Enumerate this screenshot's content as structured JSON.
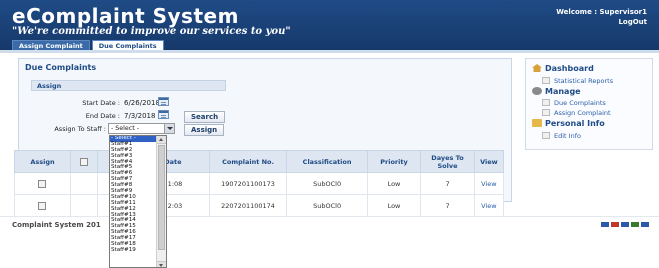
{
  "header": {
    "title": "eComplaint System",
    "tagline": "\"We're committed to improve our services to you\"",
    "welcome": "Welcome : Supervisor1",
    "logout": "LogOut"
  },
  "tabs": [
    "Assign Complaint",
    "Due Complaints"
  ],
  "main": {
    "section_title": "Due Complaints",
    "subsection": "Assign",
    "start_date_label": "Start Date :",
    "start_date_value": "6/26/2018",
    "end_date_label": "End Date :",
    "end_date_value": "7/3/2018",
    "search_button": "Search",
    "assign_to_label": "Assign To Staff :",
    "assign_to_value": "- Select -",
    "assign_button": "Assign"
  },
  "dropdown_options": [
    "- Select -",
    "Staff#1",
    "Staff#2",
    "Staff#3",
    "Staff#4",
    "Staff#5",
    "Staff#6",
    "Staff#7",
    "Staff#8",
    "Staff#9",
    "Staff#10",
    "Staff#11",
    "Staff#12",
    "Staff#13",
    "Staff#14",
    "Staff#15",
    "Staff#16",
    "Staff#17",
    "Staff#18",
    "Staff#19"
  ],
  "table": {
    "headers": [
      "Assign",
      "",
      "Complaint Date",
      "Complaint No.",
      "Classification",
      "Priority",
      "Dayes To Solve",
      "View"
    ],
    "rows": [
      {
        "date": "19:07:2018 11:08",
        "number": "1907201100173",
        "classification": "SubOCl0",
        "priority": "Low",
        "days": "7",
        "view": "View"
      },
      {
        "date": "22:07:2018 12:03",
        "number": "2207201100174",
        "classification": "SubOCl0",
        "priority": "Low",
        "days": "7",
        "view": "View"
      }
    ]
  },
  "sidebar": {
    "dashboard": "Dashboard",
    "statistical_reports": "Statistical Reports",
    "manage": "Manage",
    "due_complaints": "Due Complaints",
    "assign_complaint": "Assign Complaint",
    "personal_info": "Personal Info",
    "edit_info": "Edit Info"
  },
  "footer": {
    "text": "Complaint System 201",
    "blocks": [
      "#2c5aa8",
      "#c0392b",
      "#2c5aa8",
      "#3b7a2a",
      "#2c5aa8"
    ]
  },
  "colors": {
    "header_bg": "#1f4b86",
    "accent": "#2b5ea8",
    "selected_option": "#2f62c4"
  }
}
